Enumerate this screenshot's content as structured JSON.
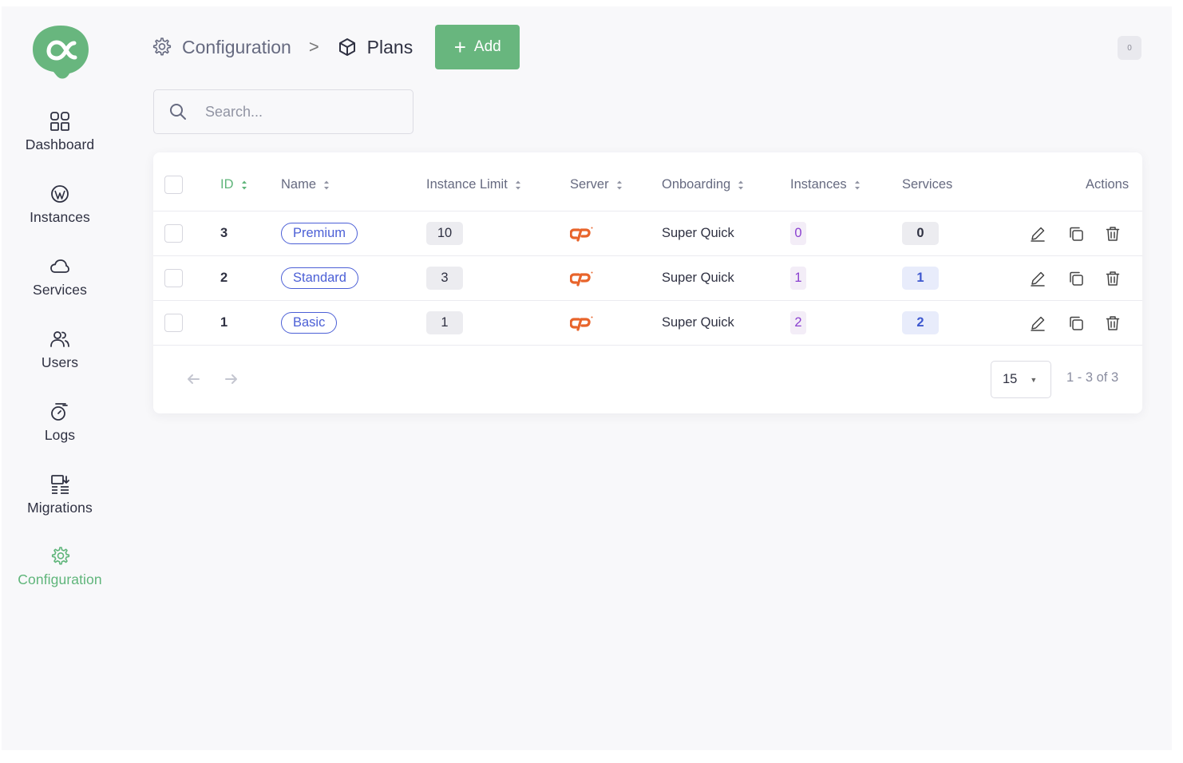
{
  "sidebar": {
    "items": [
      {
        "label": "Dashboard",
        "icon": "dashboard-icon"
      },
      {
        "label": "Instances",
        "icon": "wordpress-icon"
      },
      {
        "label": "Services",
        "icon": "cloud-icon"
      },
      {
        "label": "Users",
        "icon": "users-icon"
      },
      {
        "label": "Logs",
        "icon": "stopwatch-icon"
      },
      {
        "label": "Migrations",
        "icon": "migrations-icon"
      },
      {
        "label": "Configuration",
        "icon": "gear-icon",
        "active": true
      }
    ]
  },
  "header": {
    "breadcrumb_parent": "Configuration",
    "breadcrumb_separator": ">",
    "breadcrumb_current": "Plans",
    "add_label": "Add",
    "notification_count": "0"
  },
  "search": {
    "placeholder": "Search...",
    "value": ""
  },
  "table": {
    "columns": {
      "id": "ID",
      "name": "Name",
      "instance_limit": "Instance Limit",
      "server": "Server",
      "onboarding": "Onboarding",
      "instances": "Instances",
      "services": "Services",
      "actions": "Actions"
    },
    "rows": [
      {
        "id": "3",
        "name": "Premium",
        "instance_limit": "10",
        "server": "cpanel-logo",
        "onboarding": "Super Quick",
        "instances": "0",
        "services": "0"
      },
      {
        "id": "2",
        "name": "Standard",
        "instance_limit": "3",
        "server": "cpanel-logo",
        "onboarding": "Super Quick",
        "instances": "1",
        "services": "1"
      },
      {
        "id": "1",
        "name": "Basic",
        "instance_limit": "1",
        "server": "cpanel-logo",
        "onboarding": "Super Quick",
        "instances": "2",
        "services": "2"
      }
    ]
  },
  "pagination": {
    "per_page": "15",
    "range": "1 - 3 of 3"
  },
  "colors": {
    "accent_green": "#68b67e",
    "name_blue": "#4b5fd6",
    "instances_purple": "#8a3fd0",
    "cpanel_orange": "#e8642b"
  }
}
